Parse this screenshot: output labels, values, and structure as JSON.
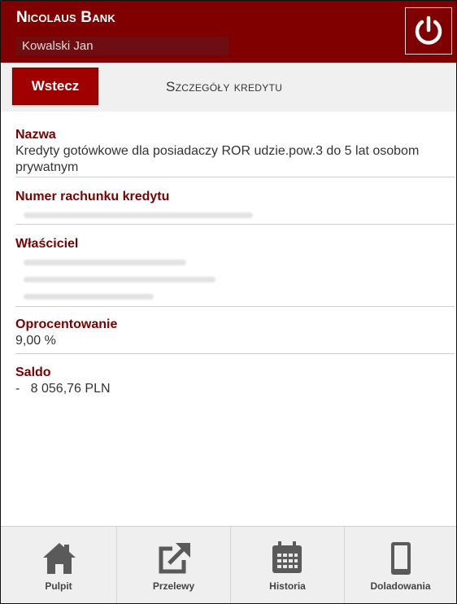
{
  "header": {
    "bank_name": "Nicolaus Bank",
    "user_name": "Kowalski Jan"
  },
  "subbar": {
    "back_label": "Wstecz",
    "title": "Szczegóły kredytu"
  },
  "fields": {
    "name": {
      "label": "Nazwa",
      "value": "Kredyty gotówkowe dla posiadaczy ROR udzie.pow.3 do 5 lat osobom prywatnym"
    },
    "account": {
      "label": "Numer rachunku kredytu"
    },
    "owner": {
      "label": "Właściciel"
    },
    "interest": {
      "label": "Oprocentowanie",
      "value": "9,00 %"
    },
    "balance": {
      "label": "Saldo",
      "value": "-   8 056,76 PLN"
    }
  },
  "nav": {
    "items": [
      {
        "label": "Pulpit",
        "icon": "home-icon"
      },
      {
        "label": "Przelewy",
        "icon": "transfer-icon"
      },
      {
        "label": "Historia",
        "icon": "calendar-icon"
      },
      {
        "label": "Doladowania",
        "icon": "phone-icon"
      }
    ]
  },
  "colors": {
    "brand": "#800000",
    "accent_button": "#a00000",
    "label_text": "#7a0000"
  }
}
